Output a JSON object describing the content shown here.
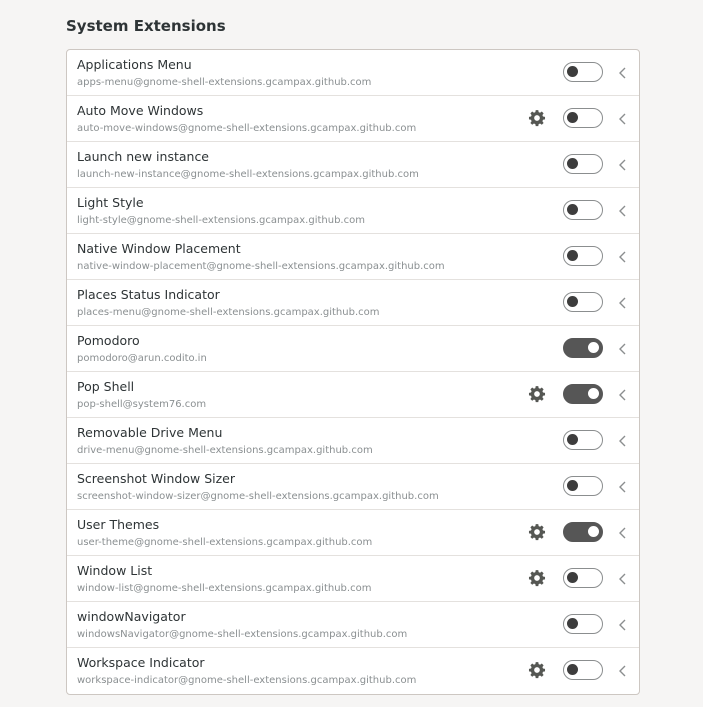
{
  "section_title": "System Extensions",
  "extensions": [
    {
      "name": "Applications Menu",
      "uuid": "apps-menu@gnome-shell-extensions.gcampax.github.com",
      "has_settings": false,
      "enabled": false
    },
    {
      "name": "Auto Move Windows",
      "uuid": "auto-move-windows@gnome-shell-extensions.gcampax.github.com",
      "has_settings": true,
      "enabled": false
    },
    {
      "name": "Launch new instance",
      "uuid": "launch-new-instance@gnome-shell-extensions.gcampax.github.com",
      "has_settings": false,
      "enabled": false
    },
    {
      "name": "Light Style",
      "uuid": "light-style@gnome-shell-extensions.gcampax.github.com",
      "has_settings": false,
      "enabled": false
    },
    {
      "name": "Native Window Placement",
      "uuid": "native-window-placement@gnome-shell-extensions.gcampax.github.com",
      "has_settings": false,
      "enabled": false
    },
    {
      "name": "Places Status Indicator",
      "uuid": "places-menu@gnome-shell-extensions.gcampax.github.com",
      "has_settings": false,
      "enabled": false
    },
    {
      "name": "Pomodoro",
      "uuid": "pomodoro@arun.codito.in",
      "has_settings": false,
      "enabled": true
    },
    {
      "name": "Pop Shell",
      "uuid": "pop-shell@system76.com",
      "has_settings": true,
      "enabled": true
    },
    {
      "name": "Removable Drive Menu",
      "uuid": "drive-menu@gnome-shell-extensions.gcampax.github.com",
      "has_settings": false,
      "enabled": false
    },
    {
      "name": "Screenshot Window Sizer",
      "uuid": "screenshot-window-sizer@gnome-shell-extensions.gcampax.github.com",
      "has_settings": false,
      "enabled": false
    },
    {
      "name": "User Themes",
      "uuid": "user-theme@gnome-shell-extensions.gcampax.github.com",
      "has_settings": true,
      "enabled": true
    },
    {
      "name": "Window List",
      "uuid": "window-list@gnome-shell-extensions.gcampax.github.com",
      "has_settings": true,
      "enabled": false
    },
    {
      "name": "windowNavigator",
      "uuid": "windowsNavigator@gnome-shell-extensions.gcampax.github.com",
      "has_settings": false,
      "enabled": false
    },
    {
      "name": "Workspace Indicator",
      "uuid": "workspace-indicator@gnome-shell-extensions.gcampax.github.com",
      "has_settings": true,
      "enabled": false
    }
  ],
  "icons": {
    "settings": "gear-icon",
    "expand": "chevron-left-icon"
  }
}
